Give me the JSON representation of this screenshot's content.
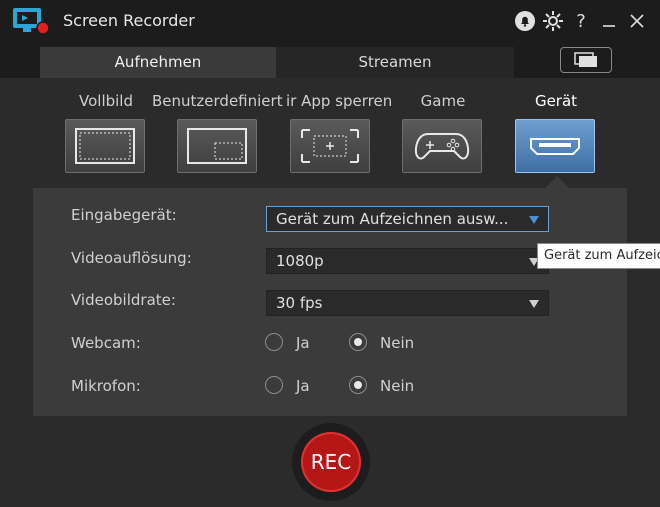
{
  "app": {
    "title": "Screen Recorder"
  },
  "tabs": {
    "record": "Aufnehmen",
    "stream": "Streamen"
  },
  "modes": [
    {
      "label": "Vollbild",
      "icon": "fullscreen-icon"
    },
    {
      "label": "Benutzerdefiniert",
      "icon": "custom-area-icon"
    },
    {
      "label": "ir App sperren",
      "icon": "lock-app-icon"
    },
    {
      "label": "Game",
      "icon": "gamepad-icon"
    },
    {
      "label": "Gerät",
      "icon": "hdmi-device-icon",
      "active": true
    }
  ],
  "form": {
    "input_device": {
      "label": "Eingabegerät:",
      "value": "Gerät zum Aufzeichnen ausw..."
    },
    "resolution": {
      "label": "Videoauflösung:",
      "value": "1080p"
    },
    "framerate": {
      "label": "Videobildrate:",
      "value": "30 fps"
    },
    "webcam": {
      "label": "Webcam:",
      "yes": "Ja",
      "no": "Nein",
      "selected": "Nein"
    },
    "mic": {
      "label": "Mikrofon:",
      "yes": "Ja",
      "no": "Nein",
      "selected": "Nein"
    }
  },
  "tooltip": "Gerät zum Aufzeichnen auswählen",
  "rec_button": "REC",
  "colors": {
    "accent": "#4c8fd4",
    "active_mode": "#5a8fc6",
    "rec": "#b51616",
    "logo": "#2aa7d6"
  }
}
